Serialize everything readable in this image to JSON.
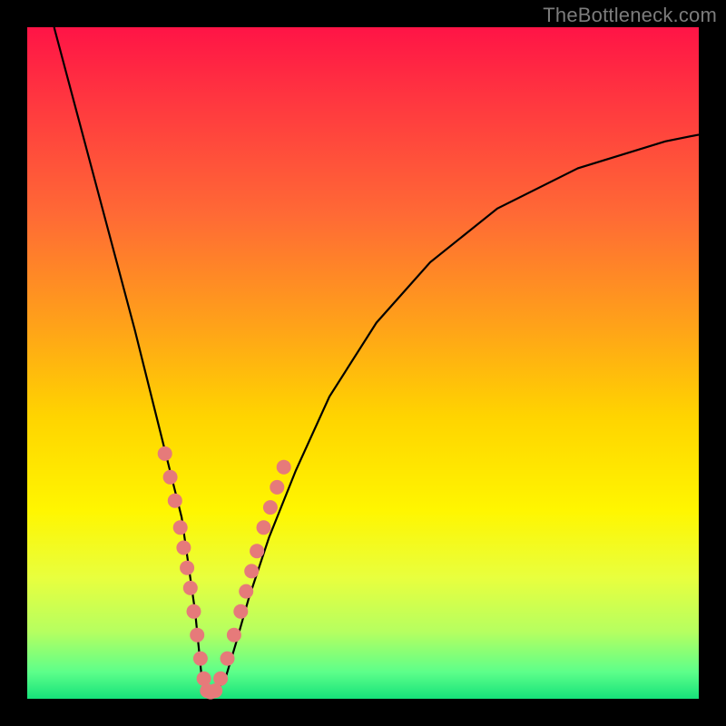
{
  "watermark": "TheBottleneck.com",
  "colors": {
    "page_bg": "#000000",
    "gradient_top": "#ff1446",
    "gradient_bottom": "#16e27a",
    "curve": "#000000",
    "dots": "#e67a7a"
  },
  "chart_data": {
    "type": "line",
    "title": "",
    "xlabel": "",
    "ylabel": "",
    "xlim": [
      0,
      100
    ],
    "ylim": [
      0,
      100
    ],
    "grid": false,
    "legend": false,
    "series": [
      {
        "name": "curve",
        "x": [
          4,
          8,
          12,
          16,
          19,
          21,
          23,
          24,
          25,
          25.5,
          26,
          27,
          28,
          29.5,
          31,
          33,
          36,
          40,
          45,
          52,
          60,
          70,
          82,
          95,
          100
        ],
        "y": [
          100,
          85,
          70,
          55,
          43,
          35,
          27,
          20,
          13,
          8,
          3,
          1,
          1,
          3,
          8,
          15,
          24,
          34,
          45,
          56,
          65,
          73,
          79,
          83,
          84
        ]
      }
    ],
    "highlight_points": {
      "name": "dots",
      "x": [
        20.5,
        21.3,
        22.0,
        22.8,
        23.3,
        23.8,
        24.3,
        24.8,
        25.3,
        25.8,
        26.3,
        26.8,
        27.3,
        28.0,
        28.8,
        29.8,
        30.8,
        31.8,
        32.6,
        33.4,
        34.2,
        35.2,
        36.2,
        37.2,
        38.2
      ],
      "y": [
        36.5,
        33.0,
        29.5,
        25.5,
        22.5,
        19.5,
        16.5,
        13.0,
        9.5,
        6.0,
        3.0,
        1.2,
        1.0,
        1.2,
        3.0,
        6.0,
        9.5,
        13.0,
        16.0,
        19.0,
        22.0,
        25.5,
        28.5,
        31.5,
        34.5
      ]
    }
  }
}
